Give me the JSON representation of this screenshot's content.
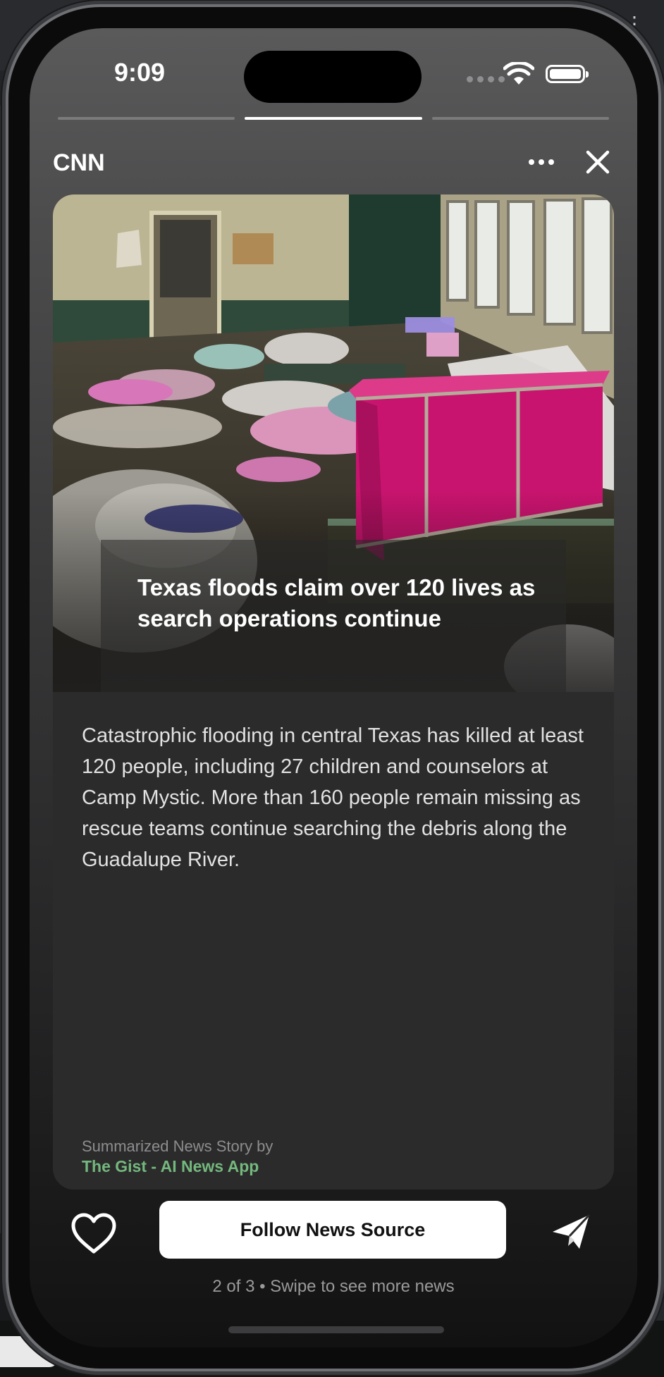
{
  "status_bar": {
    "time": "9:09",
    "icons": [
      "signal-dots-icon",
      "wifi-icon",
      "battery-icon"
    ]
  },
  "story_progress": {
    "total": 3,
    "current": 2
  },
  "header": {
    "source": "CNN",
    "more_icon": "ellipsis-icon",
    "close_icon": "close-icon"
  },
  "card": {
    "headline": "Texas floods claim over 120 lives as search operations continue",
    "summary": "Catastrophic flooding in central Texas has killed at least 120 people, including 27 children and counselors at Camp Mystic. More than 160 people remain missing as rescue teams continue searching the debris along the Guadalupe River.",
    "credit_label": "Summarized News Story by",
    "credit_app": "The Gist - AI News App"
  },
  "actions": {
    "like_icon": "heart-icon",
    "follow_label": "Follow News Source",
    "share_icon": "paper-plane-icon"
  },
  "footer": {
    "pager": "2 of 3 • Swipe to see more news"
  },
  "colors": {
    "accent_green": "#74b87d",
    "card_background": "#2b2b2c",
    "trunk_pink": "#c8146e"
  }
}
